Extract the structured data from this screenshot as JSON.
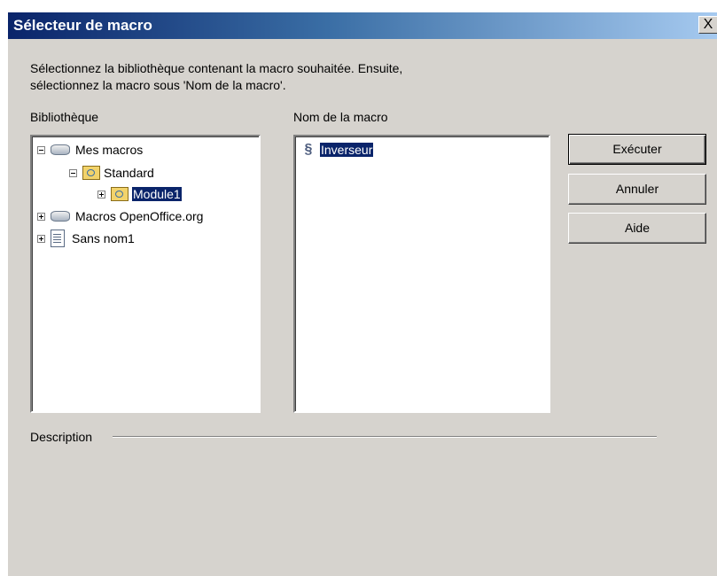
{
  "window": {
    "title": "Sélecteur de macro",
    "close_label": "X"
  },
  "instructions": {
    "line1": "Sélectionnez la bibliothèque contenant la macro souhaitée. Ensuite,",
    "line2": "sélectionnez la macro sous 'Nom de la macro'."
  },
  "library": {
    "label": "Bibliothèque",
    "tree": [
      {
        "label": "Mes macros",
        "icon": "drive-icon",
        "expander": "minus"
      },
      {
        "label": "Standard",
        "icon": "library-folder-icon",
        "expander": "minus"
      },
      {
        "label": "Module1",
        "icon": "module-folder-icon",
        "expander": "plus",
        "selected": true
      },
      {
        "label": "Macros OpenOffice.org",
        "icon": "drive-icon",
        "expander": "plus"
      },
      {
        "label": "Sans nom1",
        "icon": "document-icon",
        "expander": "plus"
      }
    ]
  },
  "macros": {
    "label": "Nom de la macro",
    "items": [
      {
        "label": "Inverseur",
        "icon": "macro-icon",
        "selected": true
      }
    ]
  },
  "buttons": {
    "run": "Exécuter",
    "cancel": "Annuler",
    "help": "Aide"
  },
  "description": {
    "label": "Description"
  },
  "colors": {
    "dialog_bg": "#d6d3ce",
    "title_bar": "#0a246a",
    "selection": "#0a246a"
  }
}
